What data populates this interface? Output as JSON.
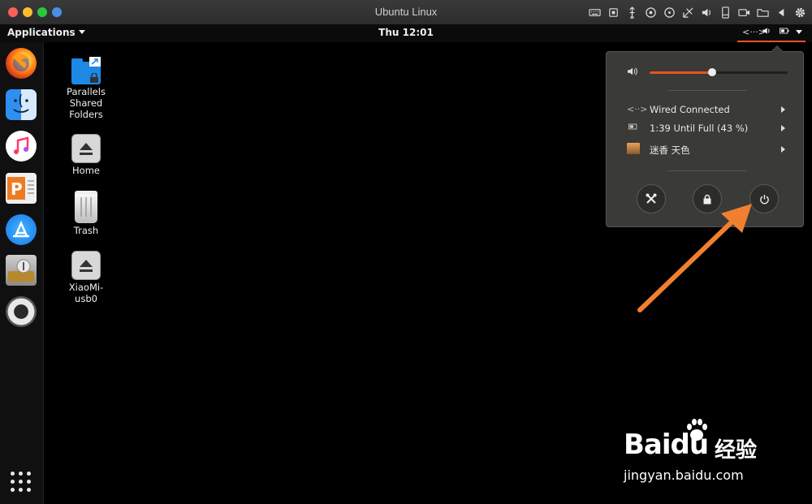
{
  "window": {
    "title": "Ubuntu Linux"
  },
  "panel": {
    "applications_label": "Applications",
    "clock": "Thu 12:01"
  },
  "dock": {
    "items": [
      {
        "name": "firefox"
      },
      {
        "name": "finder"
      },
      {
        "name": "music"
      },
      {
        "name": "presentation"
      },
      {
        "name": "app-store"
      },
      {
        "name": "disk-utility"
      },
      {
        "name": "help"
      }
    ],
    "show_apps": "app-grid-icon"
  },
  "desktop": {
    "icons": [
      {
        "label": "Parallels\nShared\nFolders",
        "icon": "shared-folder-icon"
      },
      {
        "label": "Home",
        "icon": "eject-icon"
      },
      {
        "label": "Trash",
        "icon": "trash-icon"
      },
      {
        "label": "XiaoMi-\nusb0",
        "icon": "eject-icon"
      }
    ]
  },
  "system_menu": {
    "volume_level": 0.45,
    "wired": "Wired Connected",
    "battery": "1:39 Until Full (43 %)",
    "user": "迷香 天色",
    "buttons": [
      "settings",
      "lock",
      "power"
    ]
  },
  "colors": {
    "accent": "#e95420",
    "annotation_arrow": "#f08030",
    "menu_bg": "#3a3a36"
  },
  "watermark": {
    "logo": "Baidu",
    "cn": "经验",
    "url": "jingyan.baidu.com"
  }
}
